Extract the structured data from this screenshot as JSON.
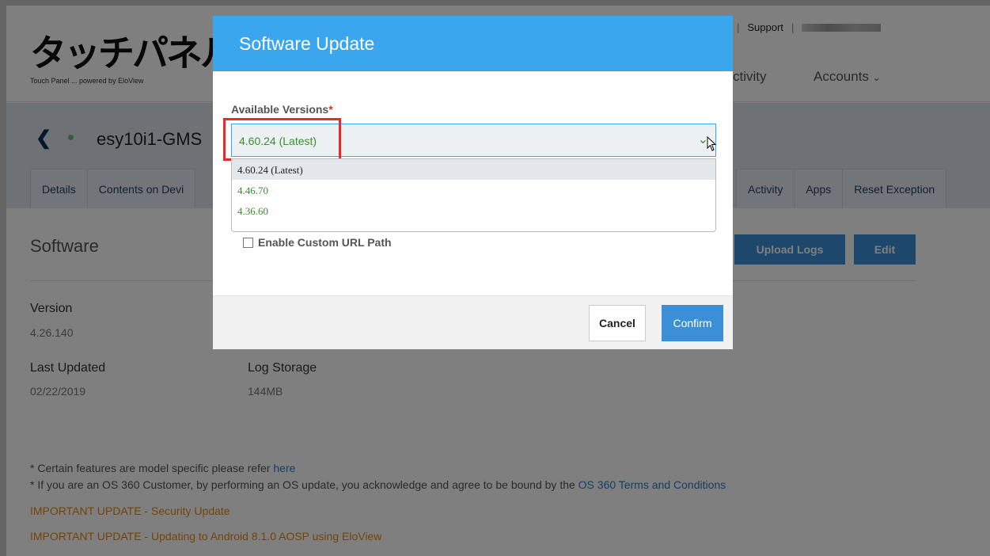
{
  "header": {
    "logo_text": "タッチパネル",
    "logo_sub": "Touch Panel ... powered by EloView",
    "support_label": "Support",
    "nav": {
      "activity": "ctivity",
      "accounts": "Accounts"
    }
  },
  "device": {
    "name": "esy10i1-GMS",
    "tabs_left": [
      "Details",
      "Contents on Devi"
    ],
    "tabs_right": [
      "Activity",
      "Apps",
      "Reset Exception"
    ]
  },
  "software": {
    "section_title": "Software",
    "upload_logs_label": "Upload Logs",
    "edit_label": "Edit",
    "version_label": "Version",
    "version_value": "4.26.140",
    "last_updated_label": "Last Updated",
    "last_updated_value": "02/22/2019",
    "log_storage_label": "Log Storage",
    "log_storage_value": "144MB"
  },
  "notes": {
    "note1_prefix": "* Certain features are model specific please refer ",
    "note1_link": "here",
    "note2_prefix": "* If you are an OS 360 Customer, by performing an OS update, you acknowledge and agree to be bound by the ",
    "note2_link": "OS 360 Terms and Conditions",
    "important1": "IMPORTANT UPDATE - Security Update",
    "important2": "IMPORTANT UPDATE - Updating to Android 8.1.0 AOSP using EloView"
  },
  "modal": {
    "title": "Software Update",
    "field_label": "Available Versions",
    "required_mark": "*",
    "selected_value": "4.60.24 (Latest)",
    "options": [
      "4.60.24 (Latest)",
      "4.46.70",
      "4.36.60"
    ],
    "custom_url_label": "Enable Custom URL Path",
    "cancel_label": "Cancel",
    "confirm_label": "Confirm"
  },
  "colors": {
    "modal_header": "#3aa6ee",
    "accent_button": "#3a8fd6",
    "version_green": "#3a8f2e",
    "important_orange": "#e08a16",
    "highlight_red": "#e12d2d"
  }
}
